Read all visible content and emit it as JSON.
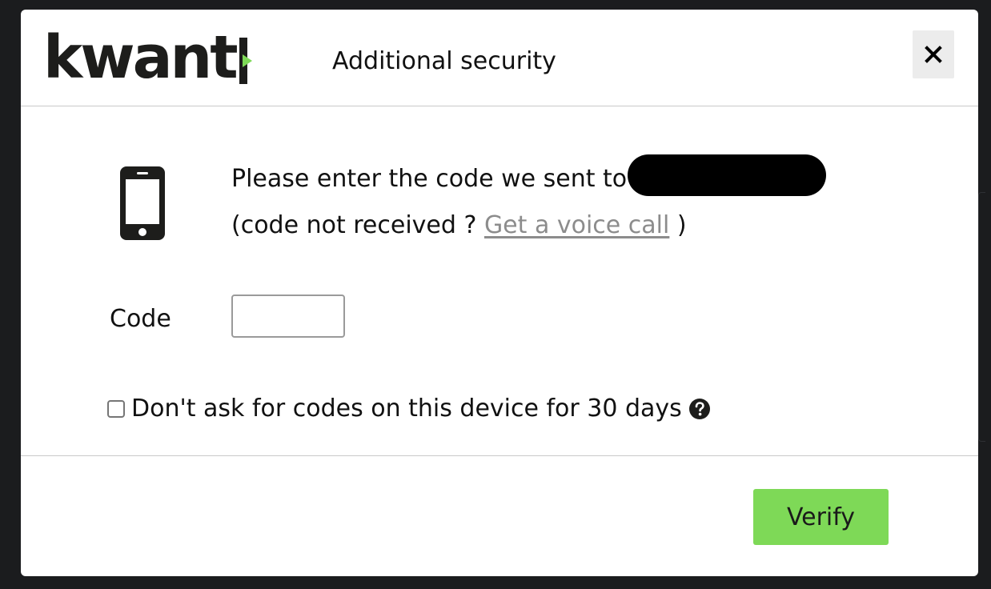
{
  "brand": {
    "logo_text": "kwant",
    "accent_color": "#7ed957",
    "dark_color": "#1d1d1b"
  },
  "modal": {
    "title": "Additional security",
    "close_icon": "close-icon",
    "message_prefix": "Please enter the code we sent to",
    "redacted_recipient": "",
    "code_not_received_prefix": "(code not received ? ",
    "voice_call_link": "Get a voice call",
    "code_not_received_suffix": " )",
    "phone_icon": "mobile-phone-icon",
    "code_label": "Code",
    "code_value": "",
    "code_placeholder": "",
    "remember_checked": false,
    "remember_label": "Don't ask for codes on this device for 30 days",
    "help_icon": "question-circle-icon",
    "verify_label": "Verify"
  }
}
